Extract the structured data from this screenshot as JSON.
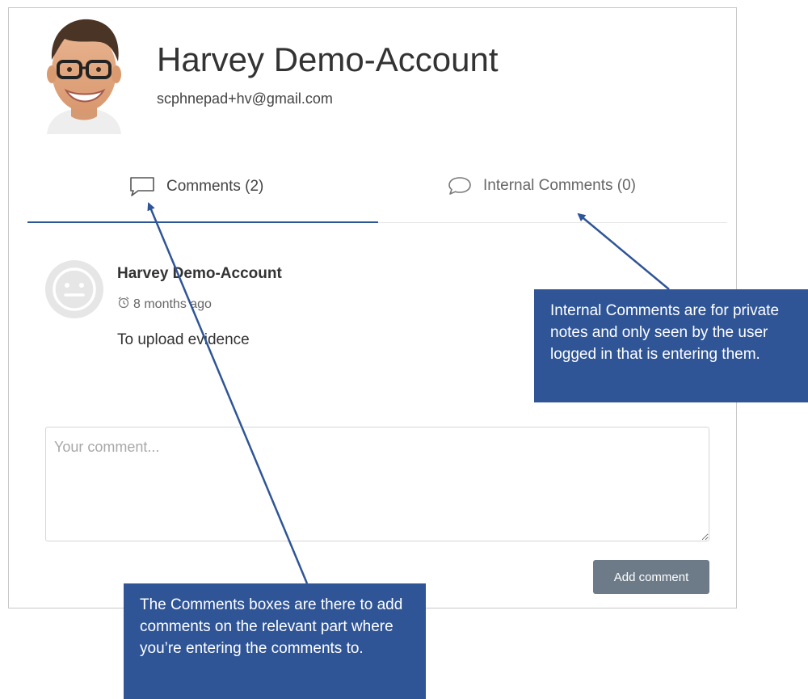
{
  "profile": {
    "name": "Harvey Demo-Account",
    "email": "scphnepad+hv@gmail.com"
  },
  "tabs": [
    {
      "label": "Comments (2)",
      "icon": "speech-bubble-icon",
      "active": true
    },
    {
      "label": "Internal Comments (0)",
      "icon": "chat-bubble-icon",
      "active": false
    }
  ],
  "comments": [
    {
      "author": "Harvey Demo-Account",
      "time": "8 months ago",
      "time_icon": "alarm-clock-icon",
      "body": "To upload evidence"
    }
  ],
  "composer": {
    "placeholder": "Your comment...",
    "submit_label": "Add comment"
  },
  "callouts": {
    "internal": "Internal Comments are for private notes and only seen by the user logged in that is entering them.",
    "comments": "The Comments boxes are there to add comments on the relevant part where you’re entering the comments to."
  },
  "colors": {
    "accent": "#2b5797",
    "callout_bg": "#2f5597",
    "button_bg": "#6d7b88"
  }
}
